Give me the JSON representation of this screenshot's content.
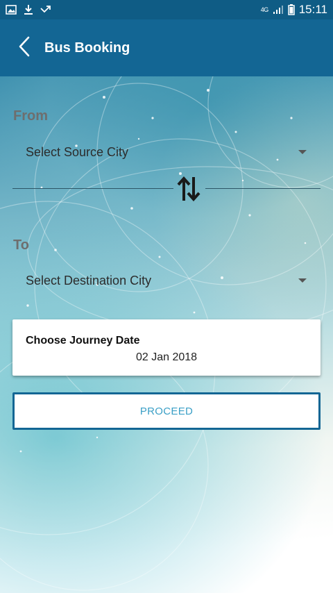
{
  "status_bar": {
    "network": "4G",
    "time": "15:11",
    "icons": [
      "gallery-icon",
      "download-icon",
      "missed-call-icon",
      "signal-icon",
      "battery-icon"
    ]
  },
  "header": {
    "title": "Bus Booking",
    "back_icon": "chevron-left-icon",
    "color": "#136694"
  },
  "form": {
    "from_label": "From",
    "source_placeholder": "Select Source City",
    "to_label": "To",
    "destination_placeholder": "Select Destination City",
    "swap_icon": "swap-vertical-icon",
    "date_title": "Choose Journey Date",
    "date_value": "02 Jan 2018",
    "proceed_label": "PROCEED"
  },
  "colors": {
    "primary": "#136694",
    "status_bar": "#0f5c85",
    "proceed_text": "#3a9fc6"
  }
}
